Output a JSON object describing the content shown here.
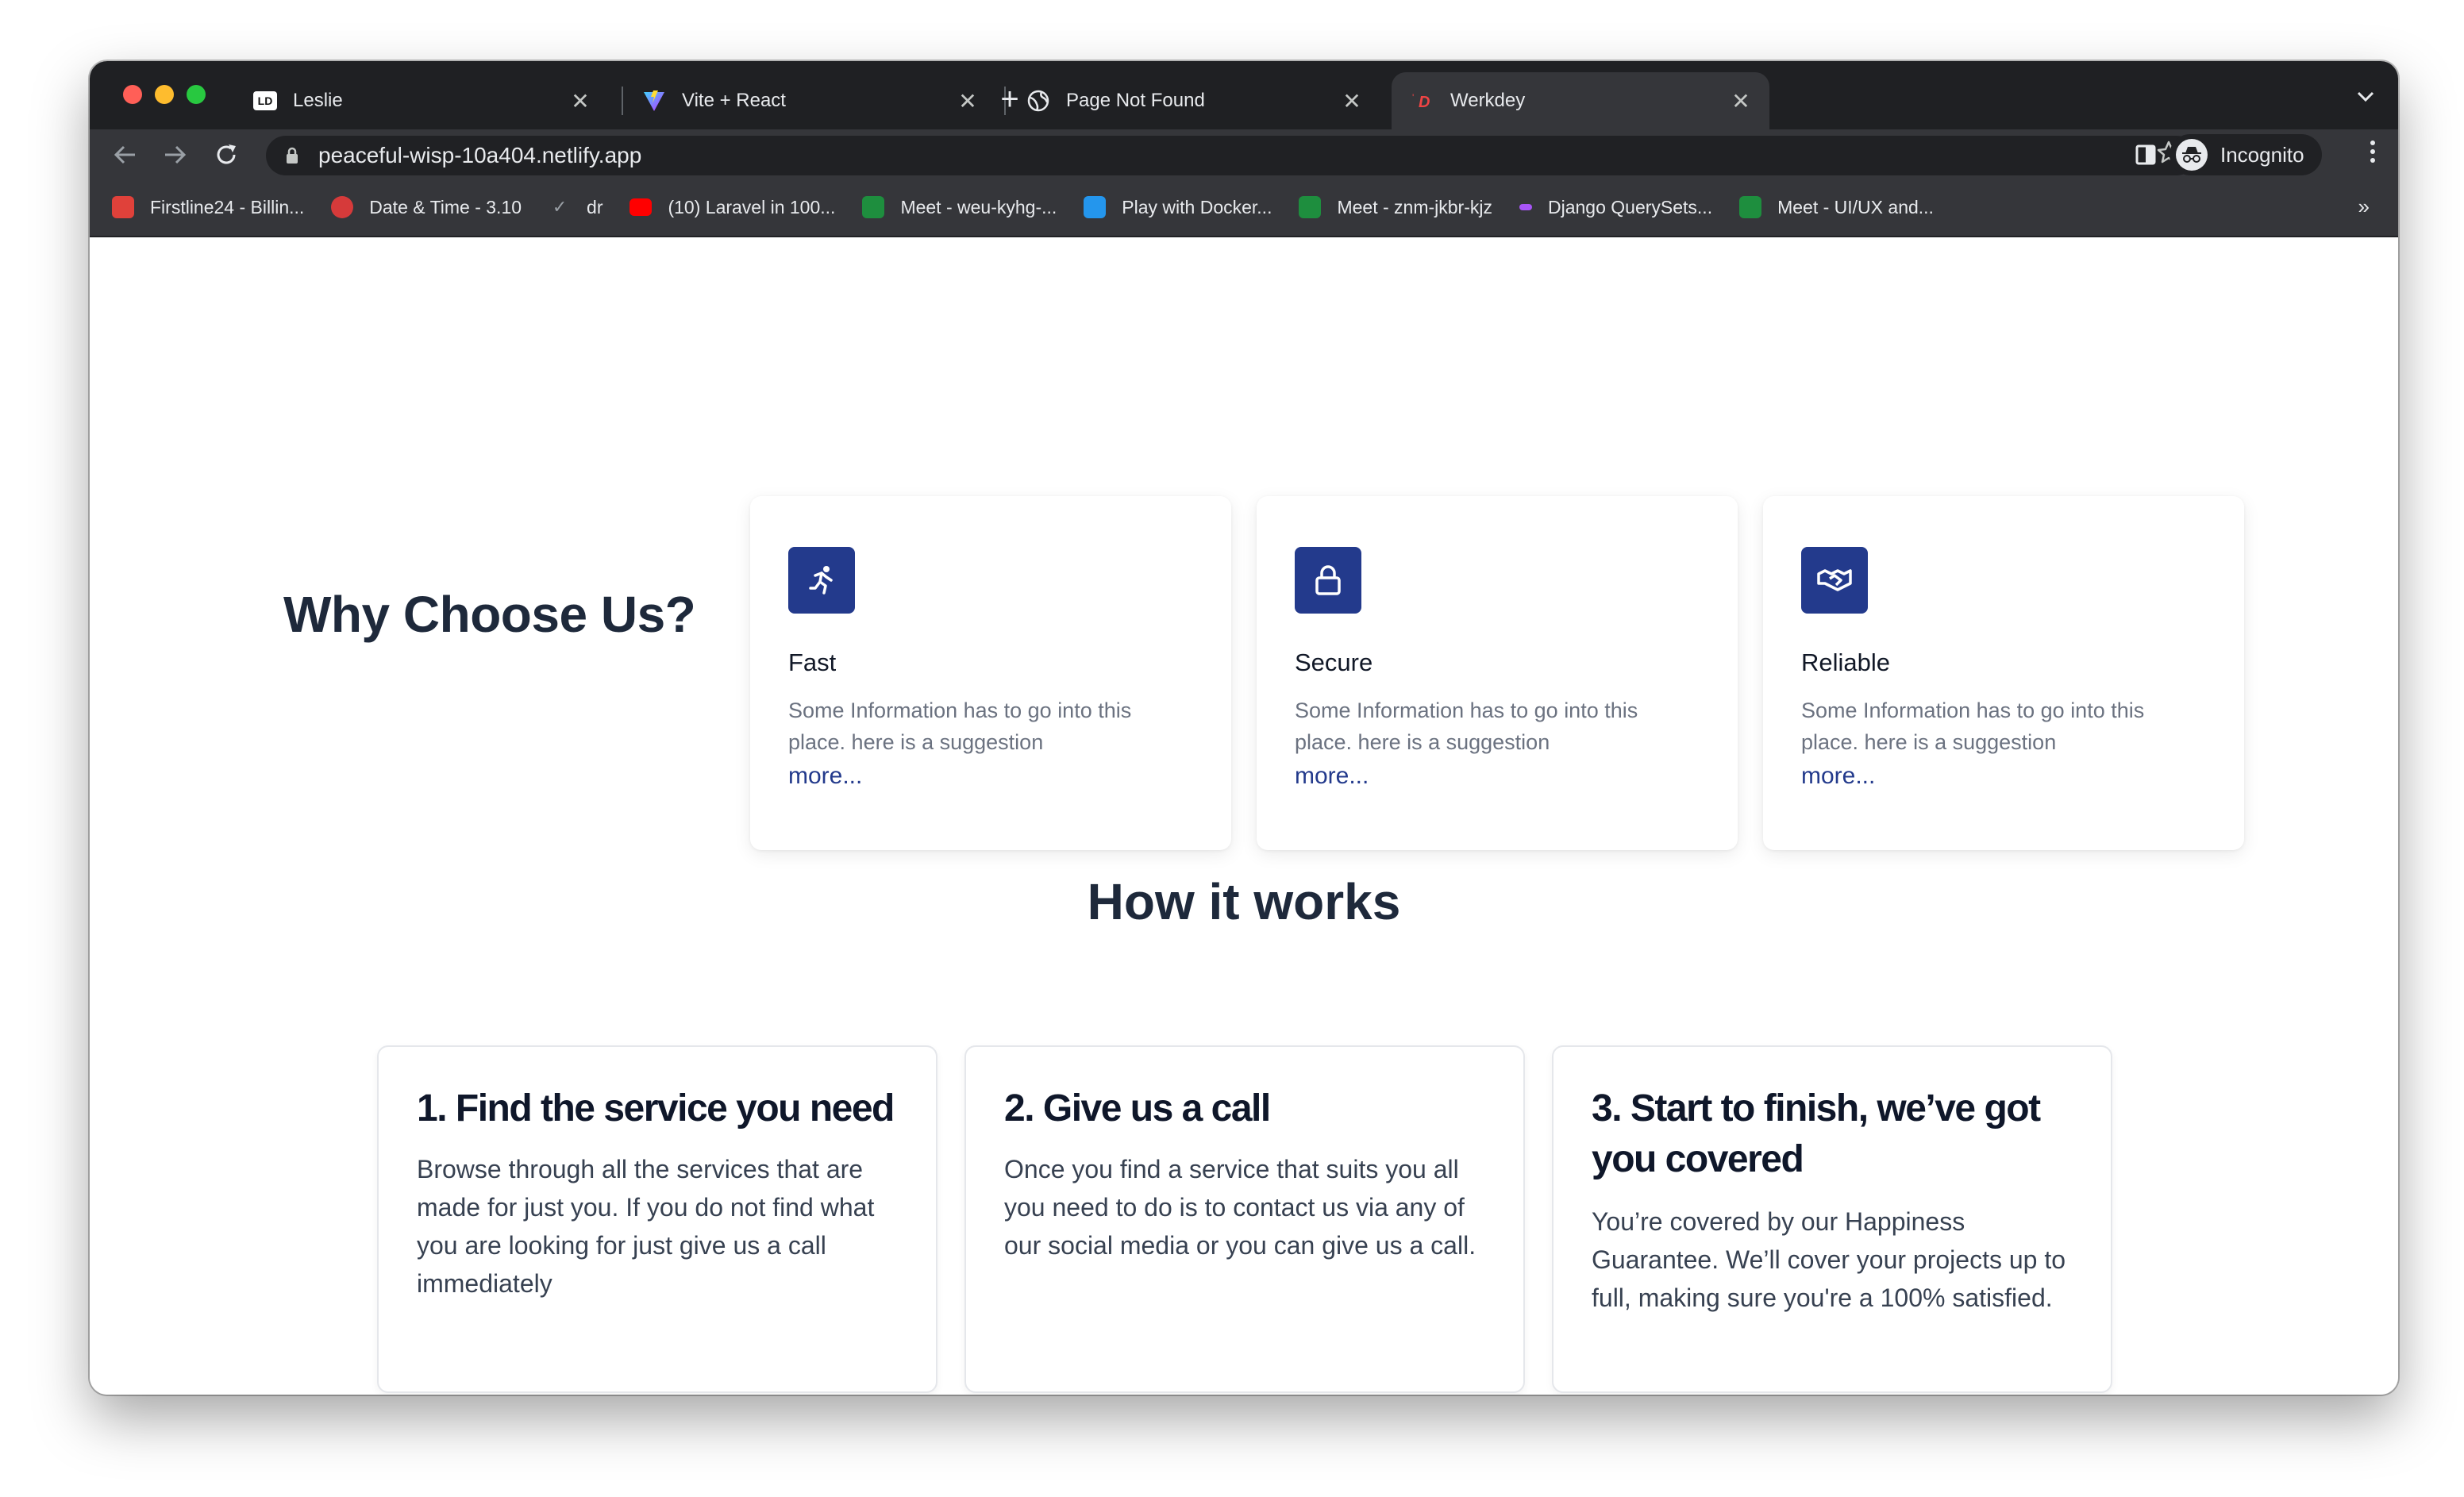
{
  "browser": {
    "tabs": [
      {
        "title": "Leslie",
        "favicon": "leslie-logo-icon",
        "active": false
      },
      {
        "title": "Vite + React",
        "favicon": "vite-logo-icon",
        "active": false
      },
      {
        "title": "Page Not Found",
        "favicon": "globe-icon",
        "active": false
      },
      {
        "title": "Werkdey",
        "favicon": "werkdey-logo-icon",
        "active": true
      }
    ],
    "close_glyph": "✕",
    "new_tab_glyph": "+",
    "url": "peaceful-wisp-10a404.netlify.app",
    "profile_label": "Incognito",
    "bookmarks": [
      {
        "label": "Firstline24 - Billin...",
        "color": "#e0413a"
      },
      {
        "label": "Date & Time - 3.10",
        "color": "#d63a3a"
      },
      {
        "label": "dr",
        "color": "#6b7280"
      },
      {
        "label": "(10) Laravel in 100...",
        "color": "#ff0000"
      },
      {
        "label": "Meet - weu-kyhg-...",
        "color": "#1e8e3e"
      },
      {
        "label": "Play with Docker...",
        "color": "#2496ed"
      },
      {
        "label": "Meet - znm-jkbr-kjz",
        "color": "#1e8e3e"
      },
      {
        "label": "Django QuerySets...",
        "color": "#a855f7"
      },
      {
        "label": "Meet - UI/UX and...",
        "color": "#1e8e3e"
      }
    ],
    "bookmarks_more": "»"
  },
  "why": {
    "title": "Why Choose Us?",
    "features": [
      {
        "title": "Fast",
        "icon": "running-person-icon",
        "desc": "Some Information has to go into this place. here is a suggestion",
        "more": "more..."
      },
      {
        "title": "Secure",
        "icon": "lock-icon",
        "desc": "Some Information has to go into this place. here is a suggestion",
        "more": "more..."
      },
      {
        "title": "Reliable",
        "icon": "handshake-icon",
        "desc": "Some Information has to go into this place. here is a suggestion",
        "more": "more..."
      }
    ]
  },
  "how": {
    "title": "How it works",
    "steps": [
      {
        "title": "1. Find the service you need",
        "desc": "Browse through all the services that are made for just you. If you do not find what you are looking for just give us a call immediately"
      },
      {
        "title": "2. Give us a call",
        "desc": "Once you find a service that suits you all you need to do is to contact us via any of our social media or you can give us a call."
      },
      {
        "title": "3. Start to finish, we’ve got you covered",
        "desc": "You’re covered by our Happiness Guarantee. We’ll cover your projects up to full, making sure you're a 100% satisfied."
      }
    ]
  },
  "colors": {
    "accent": "#233a8c",
    "heading": "#1e293b"
  }
}
